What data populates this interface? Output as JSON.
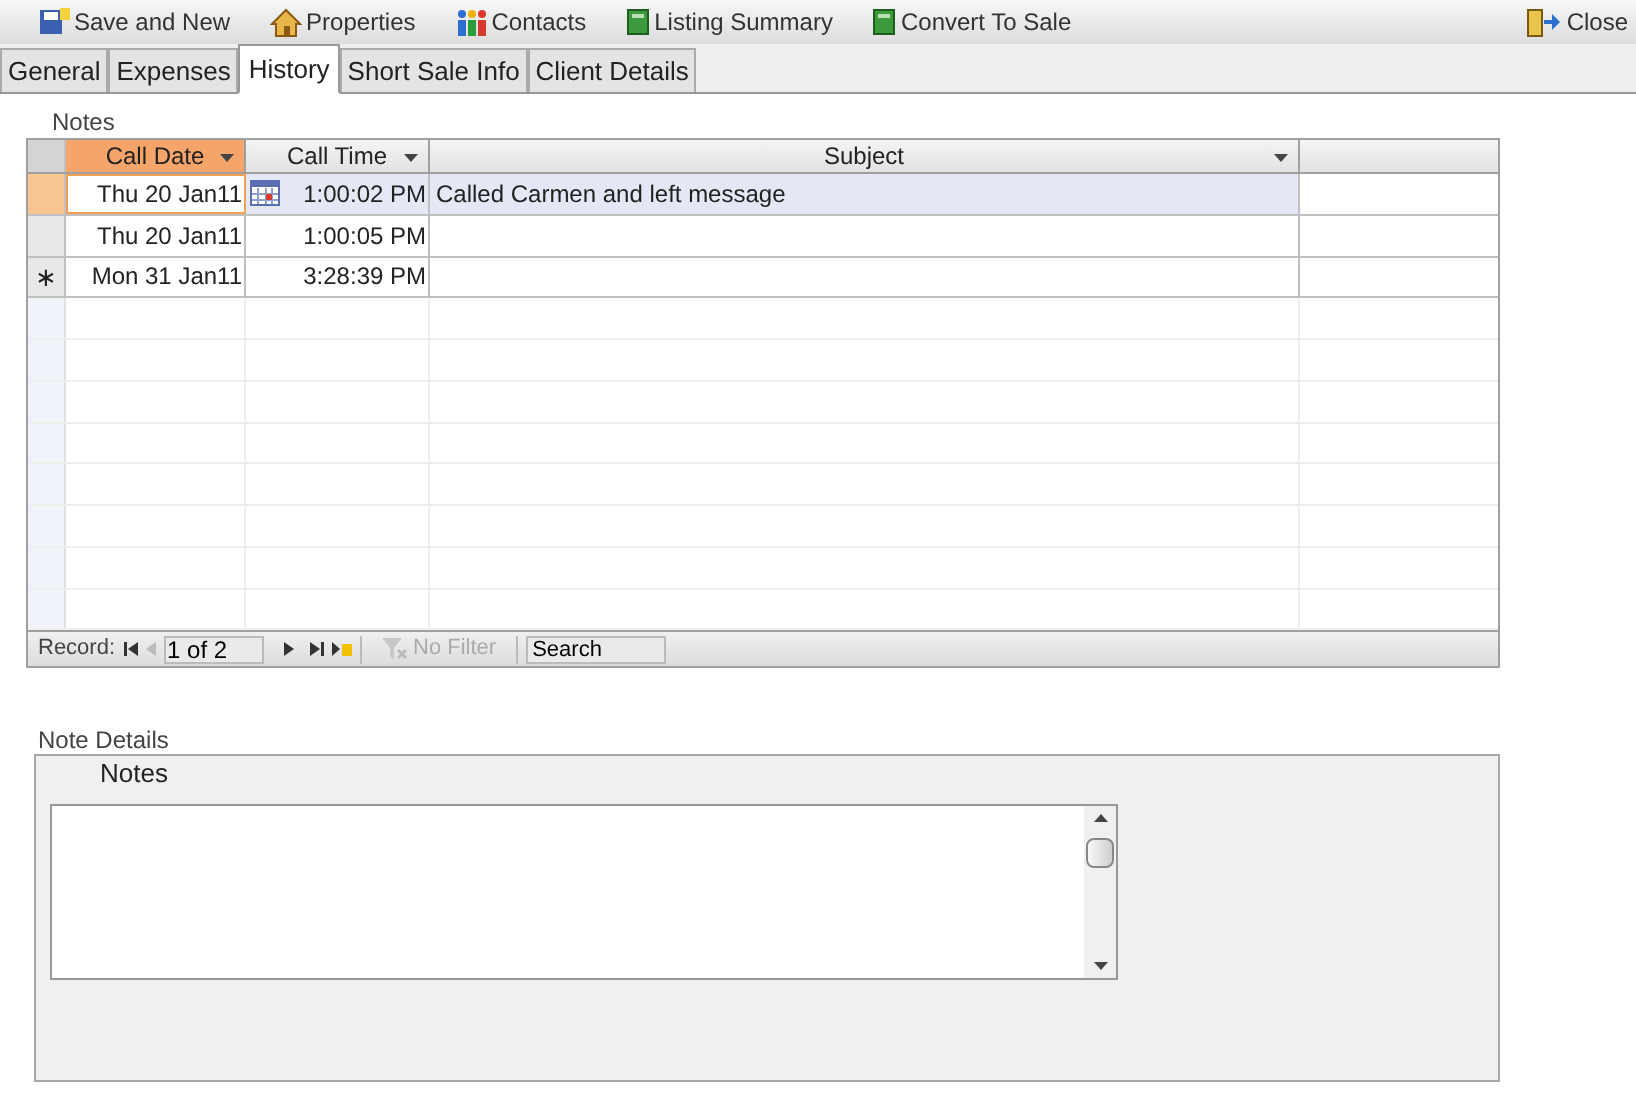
{
  "toolbar": [
    {
      "kind": "save",
      "label": "Save and New"
    },
    {
      "kind": "home",
      "label": "Properties"
    },
    {
      "kind": "people",
      "label": "Contacts"
    },
    {
      "kind": "book",
      "label": "Listing Summary"
    },
    {
      "kind": "book",
      "label": "Convert To Sale"
    }
  ],
  "close": {
    "label": "Close"
  },
  "tabs": [
    {
      "label": "General",
      "selected": false
    },
    {
      "label": "Expenses",
      "selected": false
    },
    {
      "label": "History",
      "selected": true
    },
    {
      "label": "Short Sale Info",
      "selected": false
    },
    {
      "label": "Client Details",
      "selected": false
    }
  ],
  "notes": {
    "label": "Notes",
    "columns": [
      {
        "label": "Call Date",
        "sorted": true
      },
      {
        "label": "Call Time",
        "sorted": false
      },
      {
        "label": "Subject",
        "sorted": false
      }
    ],
    "rows": [
      {
        "selected": true,
        "marker": "",
        "call_date": "Thu 20 Jan11",
        "call_time": "1:00:02 PM",
        "subject": "Called Carmen and left message"
      },
      {
        "selected": false,
        "marker": "",
        "call_date": "Thu 20 Jan11",
        "call_time": "1:00:05 PM",
        "subject": ""
      },
      {
        "selected": false,
        "marker": "∗",
        "call_date": "Mon 31 Jan11",
        "call_time": "3:28:39 PM",
        "subject": ""
      }
    ],
    "navigator": {
      "label": "Record:",
      "position": "1 of 2",
      "filter": "No Filter",
      "search": "Search"
    }
  },
  "note_details": {
    "label": "Note Details",
    "field_label": "Notes"
  }
}
